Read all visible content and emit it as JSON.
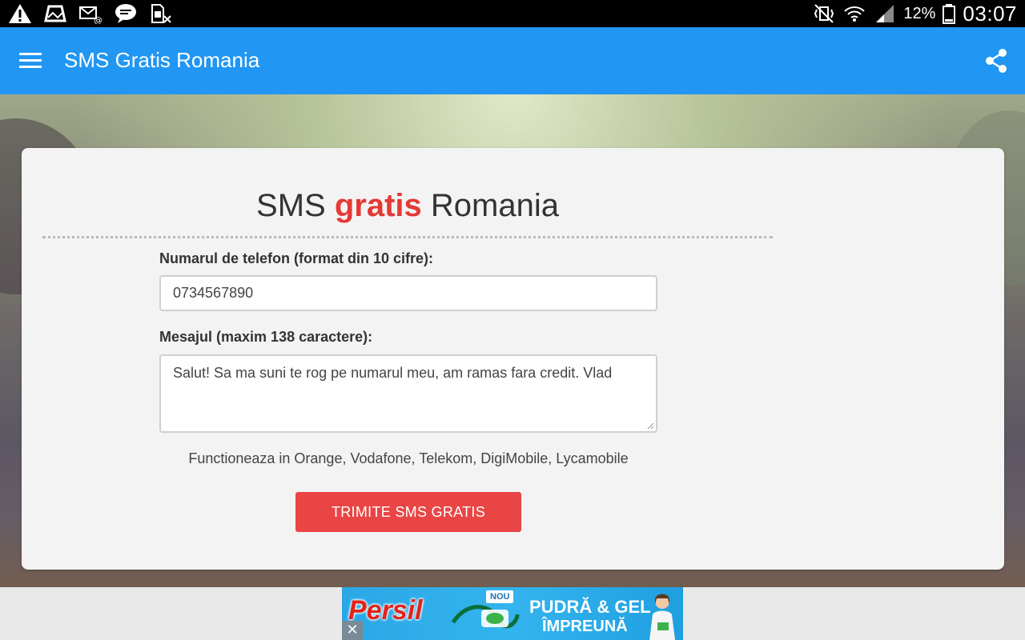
{
  "status_bar": {
    "left_icons": [
      "warning-icon",
      "inbox-icon",
      "email-icon",
      "chat-icon",
      "sim-icon"
    ],
    "right_icons": [
      "vibrate-icon",
      "wifi-icon",
      "signal-icon",
      "battery-icon"
    ],
    "battery": "12%",
    "clock": "03:07"
  },
  "app_bar": {
    "title": "SMS Gratis Romania",
    "background_color": "#2196f3",
    "left_icon": "menu-icon",
    "right_icon": "share-icon"
  },
  "card": {
    "heading": {
      "part1": "SMS ",
      "highlight": "gratis",
      "part2": " Romania",
      "highlight_color": "#e53935"
    },
    "phone_label": "Numarul de telefon (format din 10 cifre):",
    "phone_value": "0734567890",
    "message_label": "Mesajul (maxim 138 caractere):",
    "message_value": "Salut! Sa ma suni te rog pe numarul meu, am ramas fara credit. Vlad",
    "operators_note": "Functioneaza in Orange, Vodafone, Telekom, DigiMobile, Lycamobile",
    "send_button": "TRIMITE SMS GRATIS",
    "send_button_color": "#e94545"
  },
  "ad": {
    "brand": "Persil",
    "badge": "NOU",
    "line1": "PUDRĂ & GEL",
    "line2": "ÎMPREUNĂ",
    "close": "✕"
  }
}
